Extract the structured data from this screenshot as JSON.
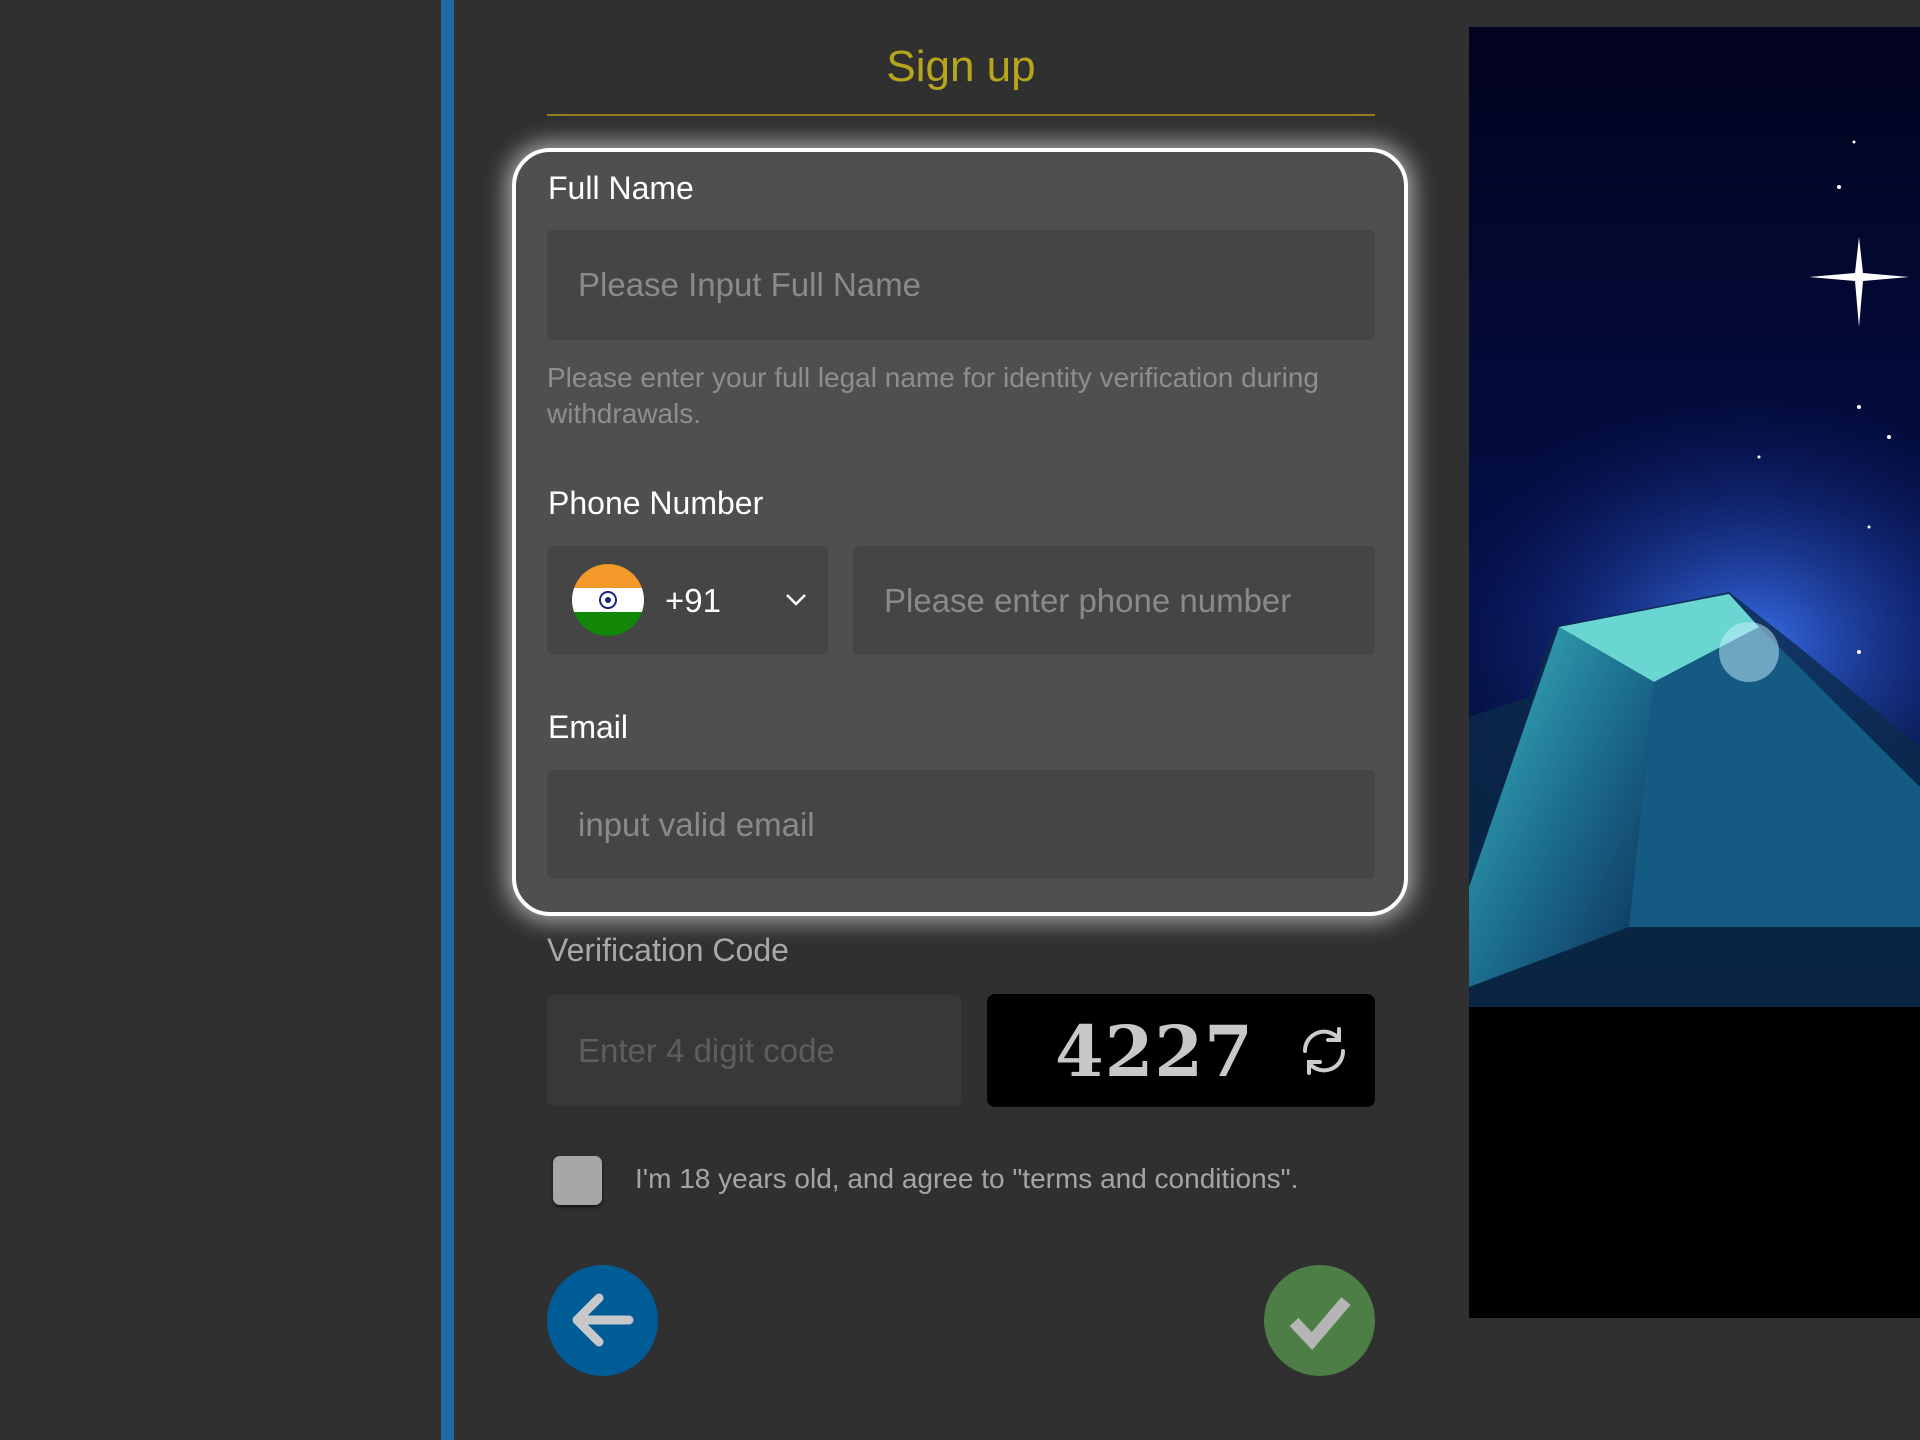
{
  "header": {
    "title": "Sign up"
  },
  "form": {
    "full_name": {
      "label": "Full Name",
      "placeholder": "Please Input Full Name",
      "help": "Please enter your full legal name for identity verification during withdrawals."
    },
    "phone": {
      "label": "Phone Number",
      "country_code": "+91",
      "country_flag": "india-flag-icon",
      "placeholder": "Please enter phone number"
    },
    "email": {
      "label": "Email",
      "placeholder": "input valid email"
    },
    "verification": {
      "label": "Verification Code",
      "placeholder": "Enter 4 digit code",
      "captcha": "4227"
    },
    "agree": {
      "label": "I'm 18 years old, and agree to \"terms and conditions\".",
      "checked": false
    }
  },
  "buttons": {
    "back_icon": "arrow-left-icon",
    "submit_icon": "check-icon"
  },
  "colors": {
    "accent_gold": "#b7a51c",
    "blue": "#005c97",
    "green": "#4c7e46",
    "highlight_border": "#ffffff"
  }
}
